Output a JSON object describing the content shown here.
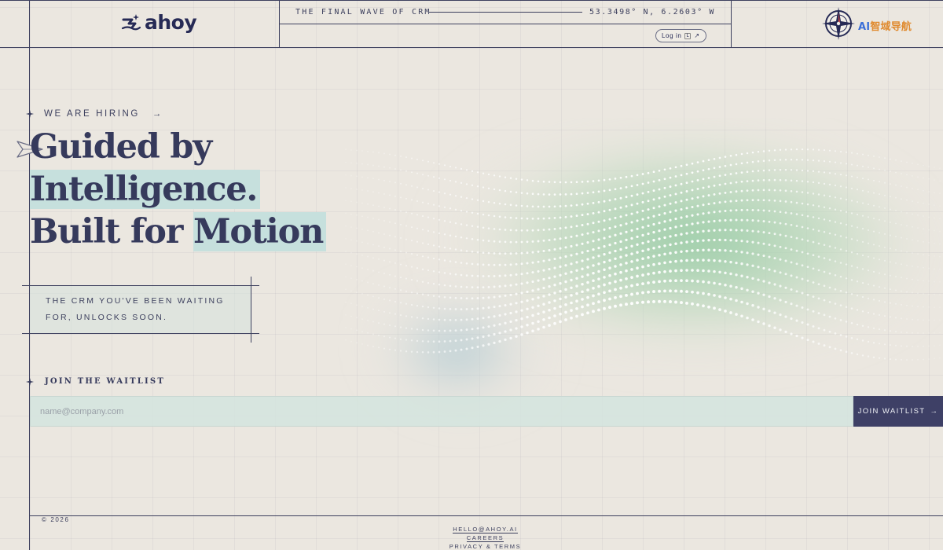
{
  "header": {
    "logo_text": "ahoy",
    "tagline": "THE FINAL WAVE OF CRM",
    "coordinates": "53.3498° N, 6.2603° W",
    "login_label": "Log in",
    "badge_prefix": "AI",
    "badge_text": "智域导航"
  },
  "hero": {
    "hiring_label": "WE ARE HIRING",
    "hiring_arrow": "→",
    "headline_line1": "Guided by",
    "headline_line2": "Intelligence.",
    "headline_line3_plain": "Built for",
    "headline_line3_highlight": "Motion",
    "subtitle": "THE CRM YOU'VE BEEN WAITING FOR, UNLOCKS SOON."
  },
  "waitlist": {
    "label": "JOIN THE WAITLIST",
    "email_placeholder": "name@company.com",
    "email_value": "",
    "button_label": "JOIN WAITLIST",
    "button_arrow": "→"
  },
  "footer": {
    "copyright": "© 2026",
    "links": [
      "HELLO@AHOY.AI",
      "CAREERS",
      "PRIVACY & TERMS"
    ]
  },
  "colors": {
    "background": "#ebe7e0",
    "ink": "#363a5c",
    "highlight": "#c6e0dd",
    "button": "#3e4066",
    "wave_green": "#9ccca8",
    "wave_blue": "#a9c7d4"
  },
  "icons": [
    "ahoy-logo-icon",
    "sparkle-icon",
    "arrow-right-icon",
    "paper-plane-icon",
    "compass-icon",
    "external-link-icon"
  ]
}
